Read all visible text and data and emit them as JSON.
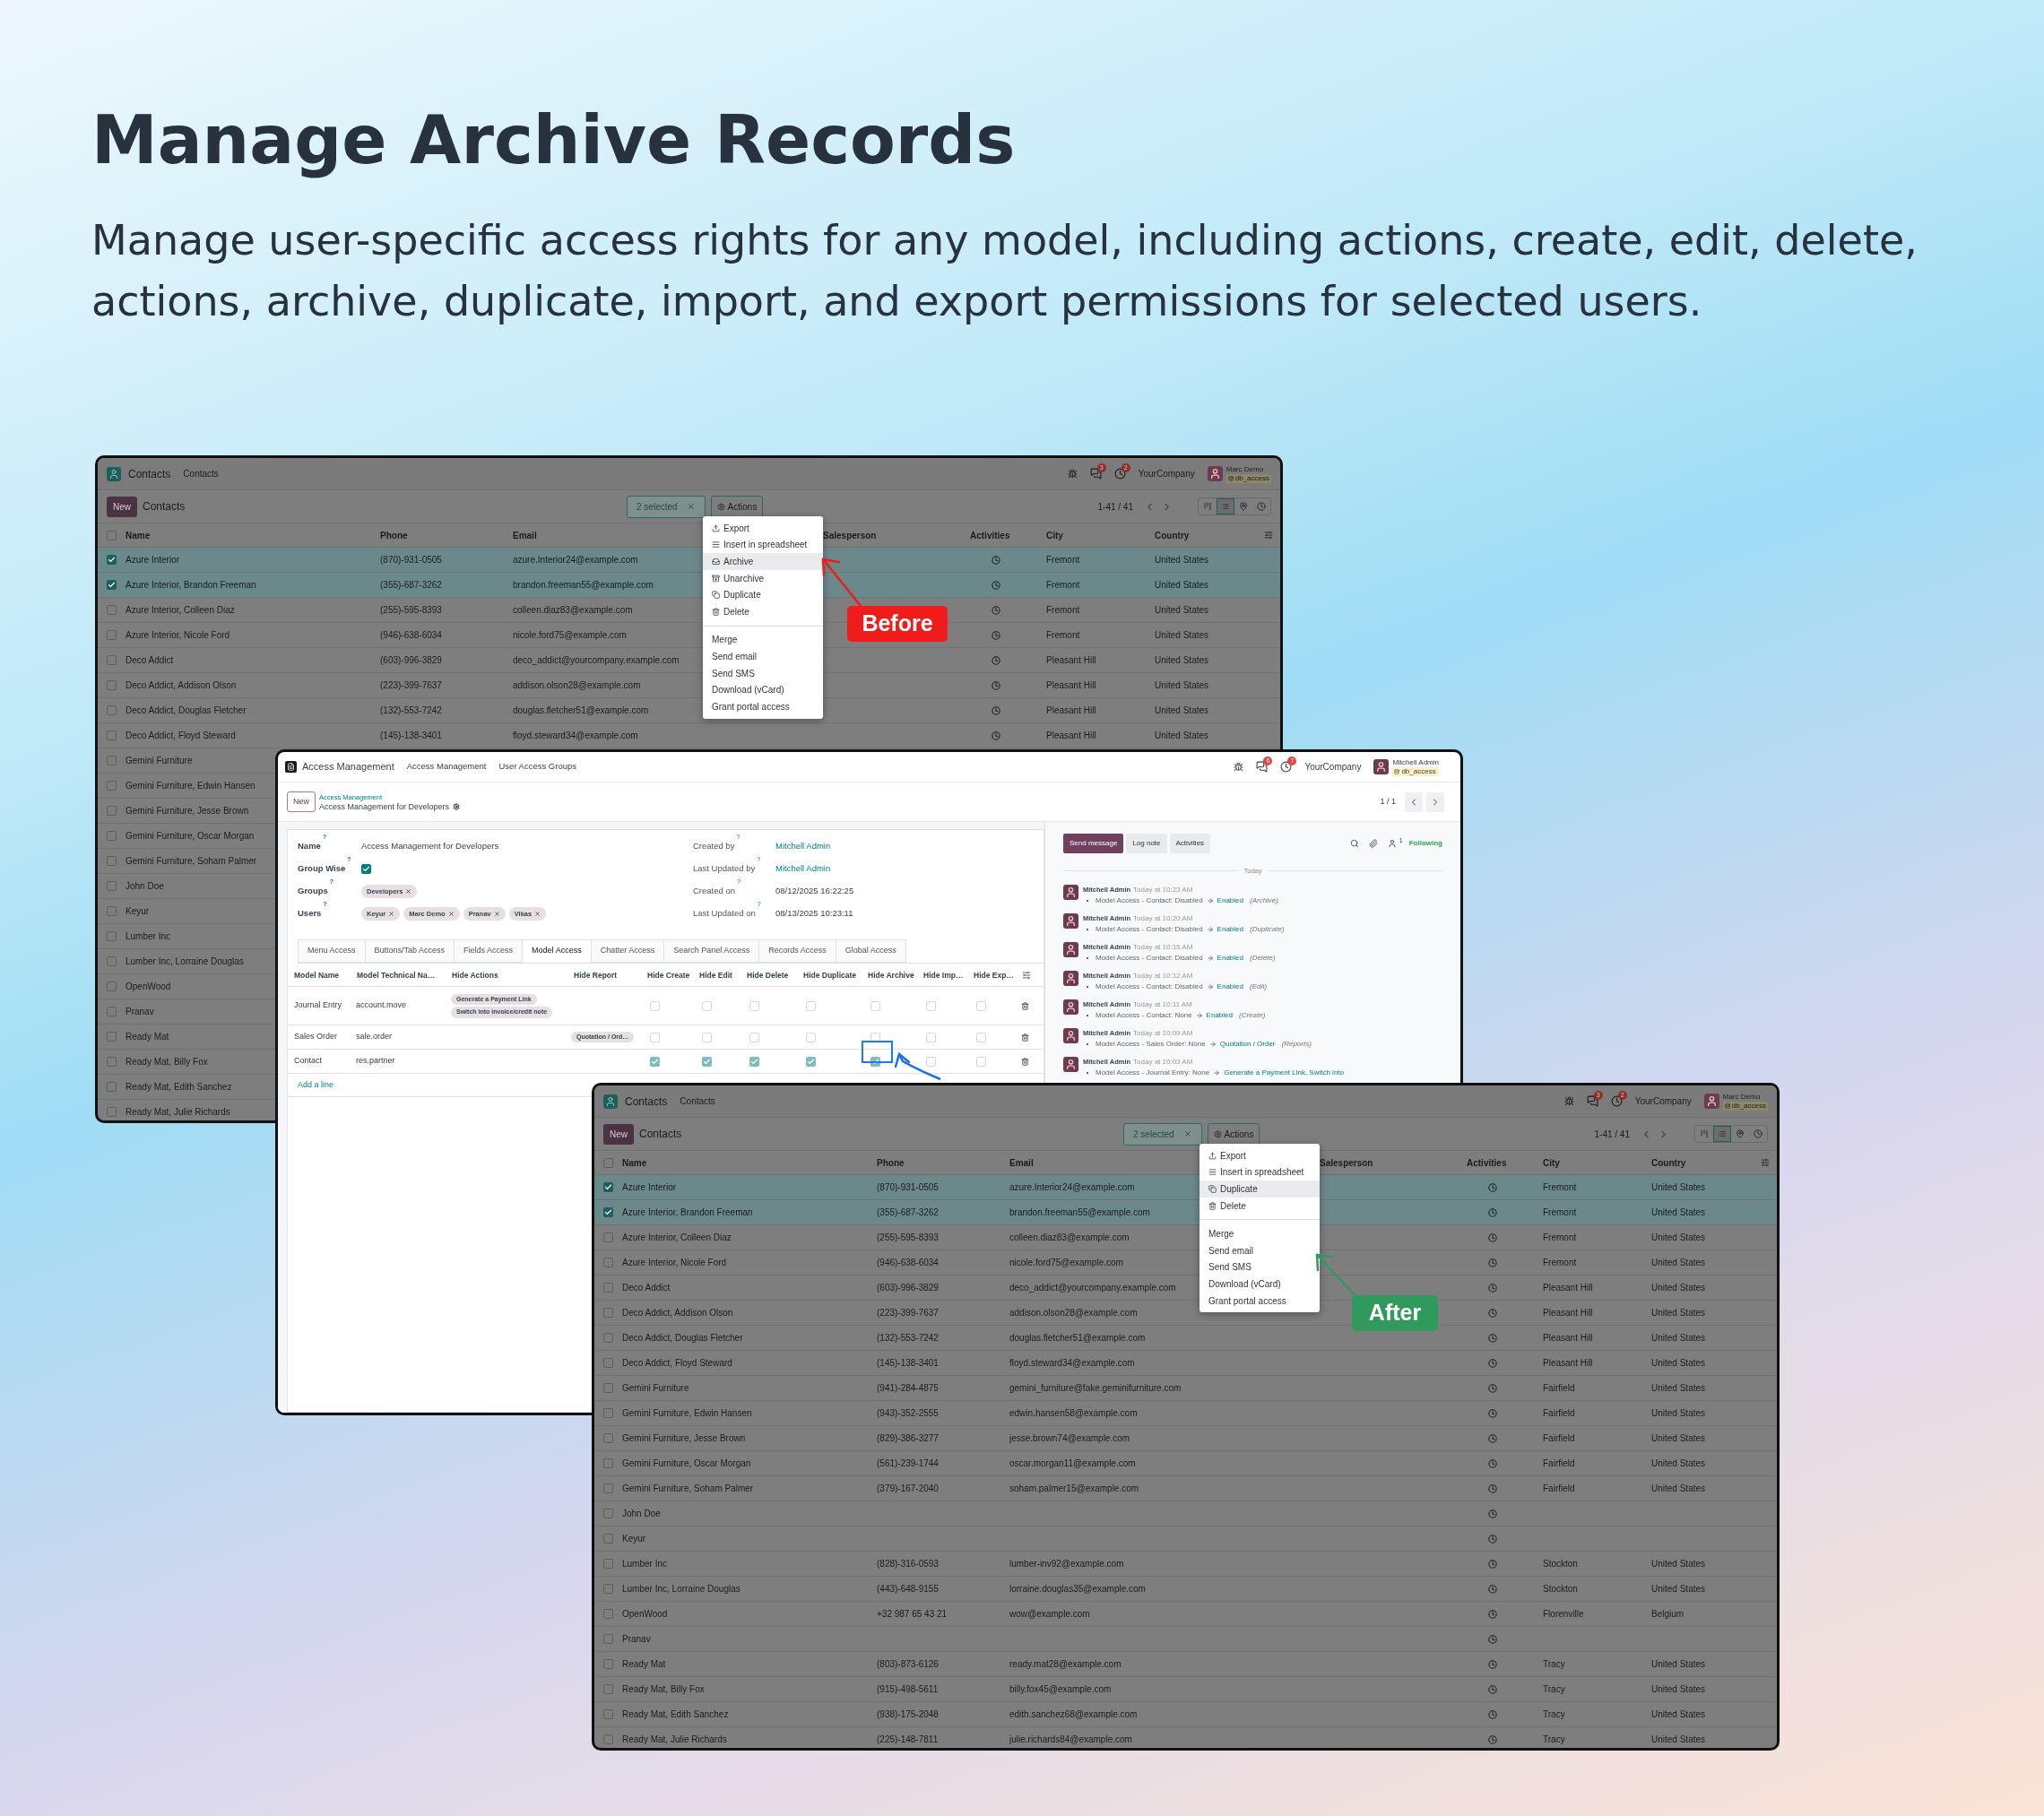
{
  "headline": {
    "title": "Manage Archive Records",
    "subtitle": "Manage user-specific access rights for any model, including actions, create, edit, delete, actions, archive, duplicate, import, and export permissions for selected users."
  },
  "before_window": {
    "select_all": false,
    "app_title": "Contacts",
    "menu": [
      "Contacts"
    ],
    "badges": [
      "3",
      "2"
    ],
    "company": "YourCompany",
    "user": {
      "name": "Marc Demo",
      "db": "db_access"
    },
    "new_button": "New",
    "breadcrumb": "Contacts",
    "selection": "2 selected",
    "actions_button": "Actions",
    "pager": "1-41 / 41",
    "columns": [
      "Name",
      "Phone",
      "Email",
      "Salesperson",
      "Activities",
      "City",
      "Country"
    ],
    "rows": [
      {
        "name": "Azure Interior",
        "phone": "(870)-931-0505",
        "email": "azure.Interior24@example.com",
        "activity": true,
        "city": "Fremont",
        "country": "United States",
        "selected": true
      },
      {
        "name": "Azure Interior, Brandon Freeman",
        "phone": "(355)-687-3262",
        "email": "brandon.freeman55@example.com",
        "activity": true,
        "city": "Fremont",
        "country": "United States",
        "selected": true
      },
      {
        "name": "Azure Interior, Colleen Diaz",
        "phone": "(255)-595-8393",
        "email": "colleen.diaz83@example.com",
        "activity": true,
        "city": "Fremont",
        "country": "United States",
        "selected": false
      },
      {
        "name": "Azure Interior, Nicole Ford",
        "phone": "(946)-638-6034",
        "email": "nicole.ford75@example.com",
        "activity": true,
        "city": "Fremont",
        "country": "United States",
        "selected": false
      },
      {
        "name": "Deco Addict",
        "phone": "(603)-996-3829",
        "email": "deco_addict@yourcompany.example.com",
        "activity": true,
        "city": "Pleasant Hill",
        "country": "United States",
        "selected": false
      },
      {
        "name": "Deco Addict, Addison Olson",
        "phone": "(223)-399-7637",
        "email": "addison.olson28@example.com",
        "activity": true,
        "city": "Pleasant Hill",
        "country": "United States",
        "selected": false
      },
      {
        "name": "Deco Addict, Douglas Fletcher",
        "phone": "(132)-553-7242",
        "email": "douglas.fletcher51@example.com",
        "activity": true,
        "city": "Pleasant Hill",
        "country": "United States",
        "selected": false
      },
      {
        "name": "Deco Addict, Floyd Steward",
        "phone": "(145)-138-3401",
        "email": "floyd.steward34@example.com",
        "activity": true,
        "city": "Pleasant Hill",
        "country": "United States",
        "selected": false
      },
      {
        "name": "Gemini Furniture",
        "selected": false
      },
      {
        "name": "Gemini Furniture, Edwin Hansen",
        "selected": false
      },
      {
        "name": "Gemini Furniture, Jesse Brown",
        "selected": false
      },
      {
        "name": "Gemini Furniture, Oscar Morgan",
        "selected": false
      },
      {
        "name": "Gemini Furniture, Soham Palmer",
        "selected": false
      },
      {
        "name": "John Doe",
        "selected": false
      },
      {
        "name": "Keyur",
        "selected": false
      },
      {
        "name": "Lumber Inc",
        "selected": false
      },
      {
        "name": "Lumber Inc, Lorraine Douglas",
        "selected": false
      },
      {
        "name": "OpenWood",
        "selected": false
      },
      {
        "name": "Pranav",
        "selected": false
      },
      {
        "name": "Ready Mat",
        "selected": false
      },
      {
        "name": "Ready Mat, Billy Fox",
        "selected": false
      },
      {
        "name": "Ready Mat, Edith Sanchez",
        "selected": false
      },
      {
        "name": "Ready Mat, Julie Richards",
        "selected": false
      }
    ],
    "menu_items": [
      {
        "label": "Export",
        "kind": "export",
        "highlighted": false
      },
      {
        "label": "Insert in spreadsheet",
        "kind": "spreadsheet",
        "highlighted": false
      },
      {
        "label": "Archive",
        "kind": "archive",
        "highlighted": true
      },
      {
        "label": "Unarchive",
        "kind": "unarchive",
        "highlighted": false
      },
      {
        "label": "Duplicate",
        "kind": "duplicate",
        "highlighted": false
      },
      {
        "label": "Delete",
        "kind": "delete",
        "highlighted": false
      },
      {
        "label": "Merge",
        "kind": "plain",
        "highlighted": false
      },
      {
        "label": "Send email",
        "kind": "plain",
        "highlighted": false
      },
      {
        "label": "Send SMS",
        "kind": "plain",
        "highlighted": false
      },
      {
        "label": "Download (vCard)",
        "kind": "plain",
        "highlighted": false
      },
      {
        "label": "Grant portal access",
        "kind": "plain",
        "highlighted": false
      }
    ]
  },
  "access_window": {
    "app_title": "Access Management",
    "menu": [
      "Access Management",
      "User Access Groups"
    ],
    "badges": [
      "6",
      "7"
    ],
    "company": "YourCompany",
    "user": {
      "name": "Mitchell Admin",
      "db": "db_access"
    },
    "new_button": "New",
    "breadcrumb_parent": "Access Management",
    "record_title": "Access Management for Developers",
    "pager": "1 / 1",
    "fields_left": [
      {
        "label": "Name",
        "help": "?",
        "kind": "text",
        "value": "Access Management for Developers"
      },
      {
        "label": "Group Wise",
        "help": "?",
        "kind": "checkbox",
        "checked": true
      },
      {
        "label": "Groups",
        "help": "?",
        "kind": "tags",
        "tags": [
          "Developers"
        ]
      },
      {
        "label": "Users",
        "help": "?",
        "kind": "tags",
        "tags": [
          "Keyur",
          "Marc Demo",
          "Pranav",
          "Vikas"
        ]
      }
    ],
    "fields_right": [
      {
        "label": "Created by",
        "help": "?",
        "kind": "link",
        "value": "Mitchell Admin"
      },
      {
        "label": "Last Updated by",
        "help": "?",
        "kind": "link",
        "value": "Mitchell Admin"
      },
      {
        "label": "Created on",
        "help": "?",
        "kind": "text",
        "value": "08/12/2025 16:22:25"
      },
      {
        "label": "Last Updated on",
        "help": "?",
        "kind": "text",
        "value": "08/13/2025 10:23:11"
      }
    ],
    "tabs": [
      {
        "label": "Menu Access",
        "selected": false
      },
      {
        "label": "Buttons/Tab Access",
        "selected": false
      },
      {
        "label": "Fields Access",
        "selected": false
      },
      {
        "label": "Model Access",
        "selected": true
      },
      {
        "label": "Chatter Access",
        "selected": false
      },
      {
        "label": "Search Panel Access",
        "selected": false
      },
      {
        "label": "Records Access",
        "selected": false
      },
      {
        "label": "Global Access",
        "selected": false
      }
    ],
    "table": {
      "columns": [
        "Model Name",
        "Model Technical Na…",
        "Hide Actions",
        "Hide Report",
        "Hide Create",
        "Hide Edit",
        "Hide Delete",
        "Hide Duplicate",
        "Hide Archive",
        "Hide Imp…",
        "Hide Exp…"
      ],
      "rows": [
        {
          "model_name": "Journal Entry",
          "technical_name": "account.move",
          "hide_actions": [
            "Generate a Payment Link",
            "Switch into invoice/credit note"
          ],
          "hide_report": [],
          "flags": [
            {
              "checked": false
            },
            {
              "checked": false
            },
            {
              "checked": false
            },
            {
              "checked": false
            },
            {
              "checked": false
            },
            {
              "checked": false
            },
            {
              "checked": false
            }
          ]
        },
        {
          "model_name": "Sales Order",
          "technical_name": "sale.order",
          "hide_actions": [],
          "hide_report": [
            "Quotation / Ord…"
          ],
          "flags": [
            {
              "checked": false
            },
            {
              "checked": false
            },
            {
              "checked": false
            },
            {
              "checked": false
            },
            {
              "checked": false
            },
            {
              "checked": false
            },
            {
              "checked": false
            }
          ]
        },
        {
          "model_name": "Contact",
          "technical_name": "res.partner",
          "hide_actions": [],
          "hide_report": [],
          "flags": [
            {
              "checked": true
            },
            {
              "checked": true
            },
            {
              "checked": true
            },
            {
              "checked": true
            },
            {
              "checked": true
            },
            {
              "checked": false
            },
            {
              "checked": false
            }
          ]
        }
      ],
      "add_line": "Add a line"
    },
    "chatter": {
      "buttons": [
        {
          "label": "Send message",
          "selected": true
        },
        {
          "label": "Log note",
          "selected": false
        },
        {
          "label": "Activities",
          "selected": false
        }
      ],
      "followers": "1",
      "following": "Following",
      "date_separator": "Today",
      "messages": [
        {
          "author": "Mitchell Admin",
          "time": "Today at 10:23 AM",
          "field": "Model Access - Contact: Disabled",
          "value": "Enabled",
          "note": "(Archive)"
        },
        {
          "author": "Mitchell Admin",
          "time": "Today at 10:20 AM",
          "field": "Model Access - Contact: Disabled",
          "value": "Enabled",
          "note": "(Duplicate)"
        },
        {
          "author": "Mitchell Admin",
          "time": "Today at 10:15 AM",
          "field": "Model Access - Contact: Disabled",
          "value": "Enabled",
          "note": "(Delete)"
        },
        {
          "author": "Mitchell Admin",
          "time": "Today at 10:12 AM",
          "field": "Model Access - Contact: Disabled",
          "value": "Enabled",
          "note": "(Edit)"
        },
        {
          "author": "Mitchell Admin",
          "time": "Today at 10:11 AM",
          "field": "Model Access - Contact: None",
          "value": "Enabled",
          "note": "(Create)"
        },
        {
          "author": "Mitchell Admin",
          "time": "Today at 10:09 AM",
          "field": "Model Access - Sales Order: None",
          "value": "Quotation / Order",
          "note": "(Reports)"
        },
        {
          "author": "Mitchell Admin",
          "time": "Today at 10:03 AM",
          "field": "Model Access - Journal Entry: None",
          "value": "Generate a Payment Link, Switch into"
        }
      ]
    }
  },
  "after_window": {
    "select_all": false,
    "app_title": "Contacts",
    "menu": [
      "Contacts"
    ],
    "badges": [
      "3",
      "2"
    ],
    "company": "YourCompany",
    "user": {
      "name": "Marc Demo",
      "db": "db_access"
    },
    "new_button": "New",
    "breadcrumb": "Contacts",
    "selection": "2 selected",
    "actions_button": "Actions",
    "pager": "1-41 / 41",
    "columns": [
      "Name",
      "Phone",
      "Email",
      "Salesperson",
      "Activities",
      "City",
      "Country"
    ],
    "rows": [
      {
        "name": "Azure Interior",
        "phone": "(870)-931-0505",
        "email": "azure.Interior24@example.com",
        "activity": true,
        "city": "Fremont",
        "country": "United States",
        "selected": true
      },
      {
        "name": "Azure Interior, Brandon Freeman",
        "phone": "(355)-687-3262",
        "email": "brandon.freeman55@example.com",
        "activity": true,
        "city": "Fremont",
        "country": "United States",
        "selected": true
      },
      {
        "name": "Azure Interior, Colleen Diaz",
        "phone": "(255)-595-8393",
        "email": "colleen.diaz83@example.com",
        "activity": true,
        "city": "Fremont",
        "country": "United States",
        "selected": false
      },
      {
        "name": "Azure Interior, Nicole Ford",
        "phone": "(946)-638-6034",
        "email": "nicole.ford75@example.com",
        "activity": true,
        "city": "Fremont",
        "country": "United States",
        "selected": false
      },
      {
        "name": "Deco Addict",
        "phone": "(603)-996-3829",
        "email": "deco_addict@yourcompany.example.com",
        "activity": true,
        "city": "Pleasant Hill",
        "country": "United States",
        "selected": false
      },
      {
        "name": "Deco Addict, Addison Olson",
        "phone": "(223)-399-7637",
        "email": "addison.olson28@example.com",
        "activity": true,
        "city": "Pleasant Hill",
        "country": "United States",
        "selected": false
      },
      {
        "name": "Deco Addict, Douglas Fletcher",
        "phone": "(132)-553-7242",
        "email": "douglas.fletcher51@example.com",
        "activity": true,
        "city": "Pleasant Hill",
        "country": "United States",
        "selected": false
      },
      {
        "name": "Deco Addict, Floyd Steward",
        "phone": "(145)-138-3401",
        "email": "floyd.steward34@example.com",
        "activity": true,
        "city": "Pleasant Hill",
        "country": "United States",
        "selected": false
      },
      {
        "name": "Gemini Furniture",
        "phone": "(941)-284-4875",
        "email": "gemini_furniture@fake.geminifurniture.com",
        "activity": true,
        "city": "Fairfield",
        "country": "United States",
        "selected": false
      },
      {
        "name": "Gemini Furniture, Edwin Hansen",
        "phone": "(943)-352-2555",
        "email": "edwin.hansen58@example.com",
        "activity": true,
        "city": "Fairfield",
        "country": "United States",
        "selected": false
      },
      {
        "name": "Gemini Furniture, Jesse Brown",
        "phone": "(829)-386-3277",
        "email": "jesse.brown74@example.com",
        "activity": true,
        "city": "Fairfield",
        "country": "United States",
        "selected": false
      },
      {
        "name": "Gemini Furniture, Oscar Morgan",
        "phone": "(561)-239-1744",
        "email": "oscar.morgan11@example.com",
        "activity": true,
        "city": "Fairfield",
        "country": "United States",
        "selected": false
      },
      {
        "name": "Gemini Furniture, Soham Palmer",
        "phone": "(379)-167-2040",
        "email": "soham.palmer15@example.com",
        "activity": true,
        "city": "Fairfield",
        "country": "United States",
        "selected": false
      },
      {
        "name": "John Doe",
        "activity": true,
        "selected": false
      },
      {
        "name": "Keyur",
        "activity": true,
        "selected": false
      },
      {
        "name": "Lumber Inc",
        "phone": "(828)-316-0593",
        "email": "lumber-inv92@example.com",
        "activity": true,
        "city": "Stockton",
        "country": "United States",
        "selected": false
      },
      {
        "name": "Lumber Inc, Lorraine Douglas",
        "phone": "(443)-648-9155",
        "email": "lorraine.douglas35@example.com",
        "activity": true,
        "city": "Stockton",
        "country": "United States",
        "selected": false
      },
      {
        "name": "OpenWood",
        "phone": "+32 987 65 43 21",
        "email": "wow@example.com",
        "activity": true,
        "city": "Florenville",
        "country": "Belgium",
        "selected": false
      },
      {
        "name": "Pranav",
        "activity": true,
        "selected": false
      },
      {
        "name": "Ready Mat",
        "phone": "(803)-873-6126",
        "email": "ready.mat28@example.com",
        "activity": true,
        "city": "Tracy",
        "country": "United States",
        "selected": false
      },
      {
        "name": "Ready Mat, Billy Fox",
        "phone": "(915)-498-5611",
        "email": "billy.fox45@example.com",
        "activity": true,
        "city": "Tracy",
        "country": "United States",
        "selected": false
      },
      {
        "name": "Ready Mat, Edith Sanchez",
        "phone": "(938)-175-2048",
        "email": "edith.sanchez68@example.com",
        "activity": true,
        "city": "Tracy",
        "country": "United States",
        "selected": false
      },
      {
        "name": "Ready Mat, Julie Richards",
        "phone": "(225)-148-7811",
        "email": "julie.richards84@example.com",
        "activity": true,
        "city": "Tracy",
        "country": "United States",
        "selected": false
      }
    ],
    "menu_items": [
      {
        "label": "Export",
        "kind": "export",
        "highlighted": false
      },
      {
        "label": "Insert in spreadsheet",
        "kind": "spreadsheet",
        "highlighted": false
      },
      {
        "label": "Duplicate",
        "kind": "duplicate",
        "highlighted": true
      },
      {
        "label": "Delete",
        "kind": "delete",
        "highlighted": false
      },
      {
        "label": "Merge",
        "kind": "plain",
        "highlighted": false
      },
      {
        "label": "Send email",
        "kind": "plain",
        "highlighted": false
      },
      {
        "label": "Send SMS",
        "kind": "plain",
        "highlighted": false
      },
      {
        "label": "Download (vCard)",
        "kind": "plain",
        "highlighted": false
      },
      {
        "label": "Grant portal access",
        "kind": "plain",
        "highlighted": false
      }
    ]
  },
  "callouts": [
    {
      "label": "Before",
      "color": "#f01c1c"
    },
    {
      "label": "After",
      "color": "#2f9a5b"
    }
  ]
}
